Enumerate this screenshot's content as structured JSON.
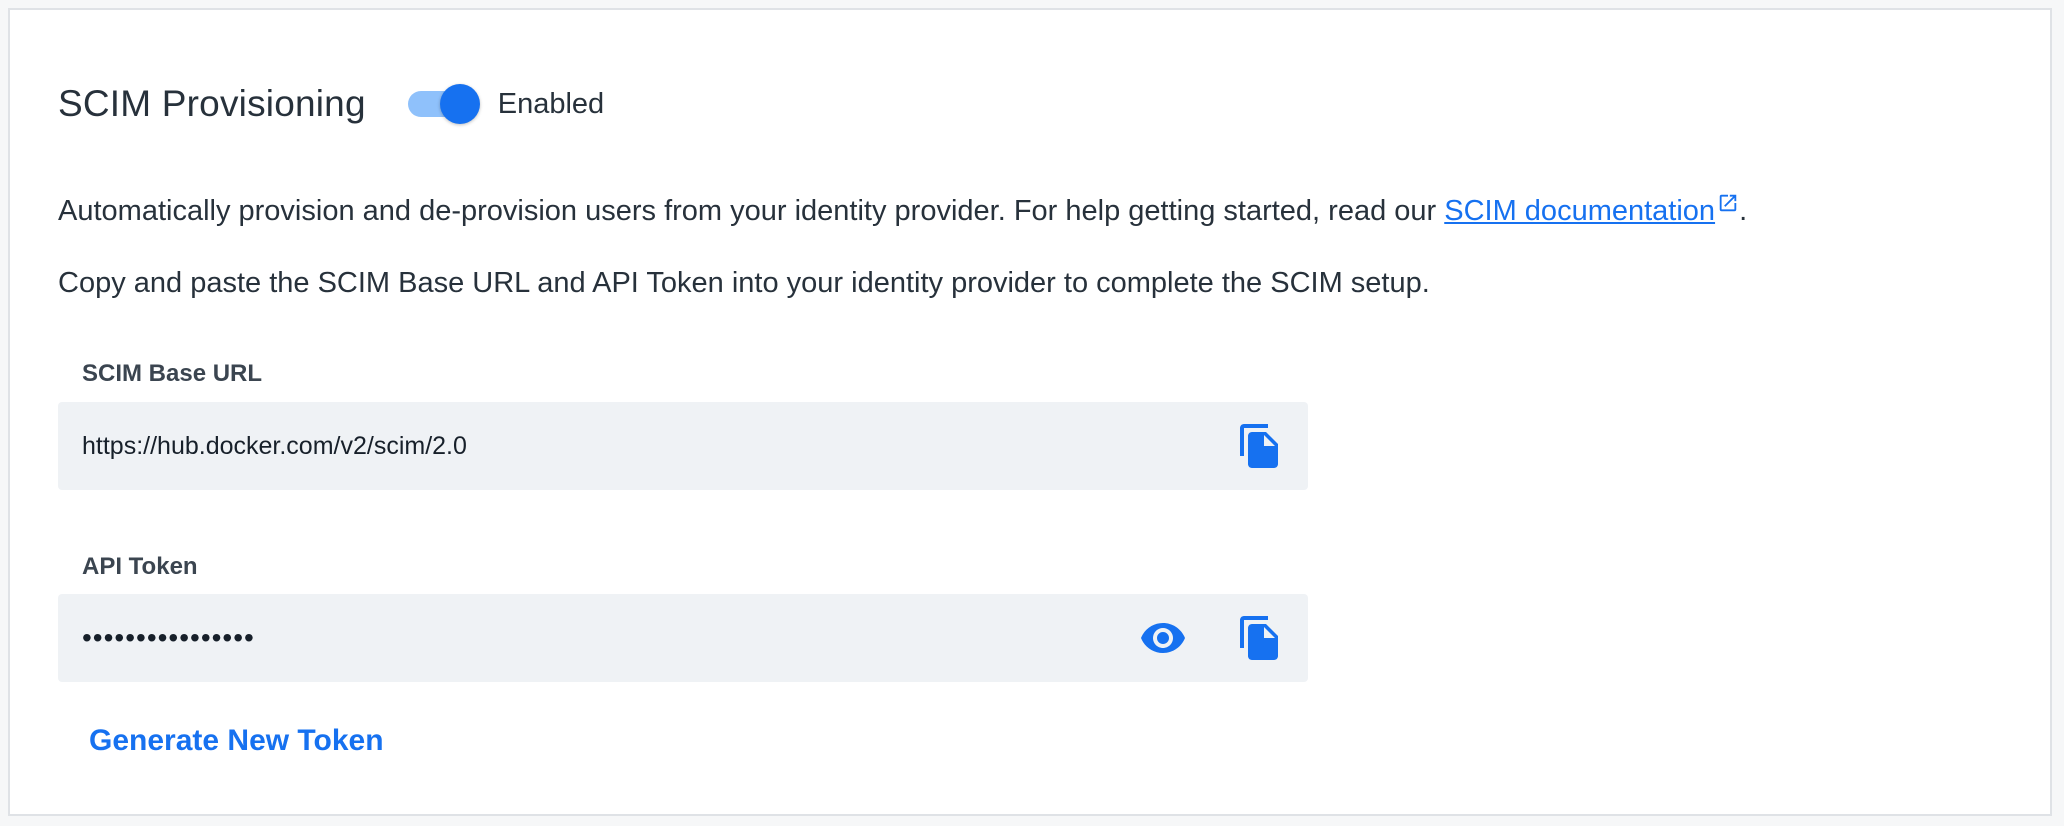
{
  "section": {
    "title": "SCIM Provisioning",
    "toggle_state": "Enabled",
    "toggle_on": true
  },
  "description": {
    "line1_text": "Automatically provision and de-provision users from your identity provider. For help getting started, read our ",
    "line1_link": "SCIM documentation",
    "line1_end": ".",
    "line2": "Copy and paste the SCIM Base URL and API Token into your identity provider to complete the SCIM setup."
  },
  "base_url": {
    "label": "SCIM Base URL",
    "value": "https://hub.docker.com/v2/scim/2.0",
    "copy_icon": "copy-icon"
  },
  "api_token": {
    "label": "API Token",
    "value": "••••••••••••••••",
    "reveal_icon": "eye-icon",
    "copy_icon": "copy-icon"
  },
  "actions": {
    "generate_label": "Generate New Token"
  },
  "colors": {
    "accent": "#1671f0",
    "toggle_track": "#8fc1fb",
    "field_bg": "#eff2f5",
    "text": "#27313b"
  }
}
